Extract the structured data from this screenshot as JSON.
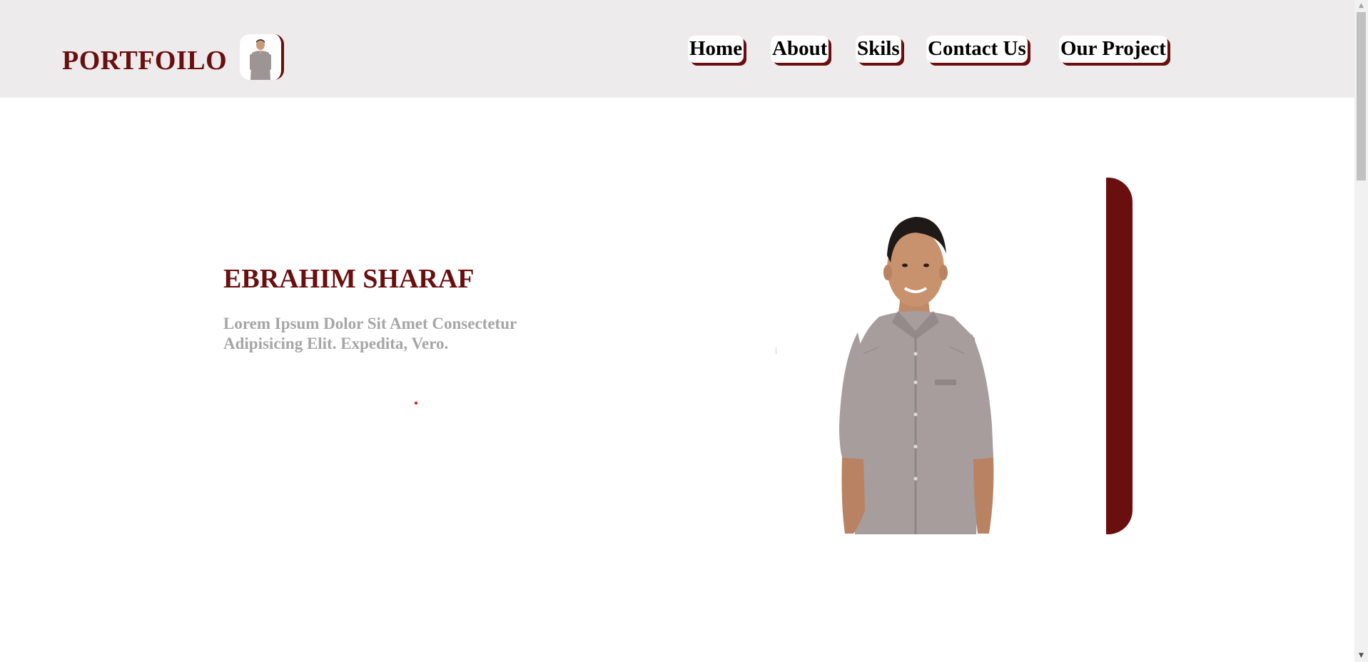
{
  "header": {
    "brand": "PORTFOILO",
    "nav": [
      {
        "label": "Home"
      },
      {
        "label": "About"
      },
      {
        "label": "Skils"
      },
      {
        "label": "Contact Us"
      },
      {
        "label": "Our Project"
      }
    ]
  },
  "hero": {
    "name": "EBRAHIM SHARAF",
    "description": "Lorem Ipsum Dolor Sit Amet Consectetur Adipisicing Elit. Expedita, Vero."
  },
  "colors": {
    "accent": "#6a0e0e",
    "header_bg": "#edebec",
    "muted_text": "#a6a6a6",
    "page_bg": "#ffffff"
  },
  "icons": {
    "scroll_up": "triangle-up-icon",
    "scroll_down": "triangle-down-icon"
  }
}
